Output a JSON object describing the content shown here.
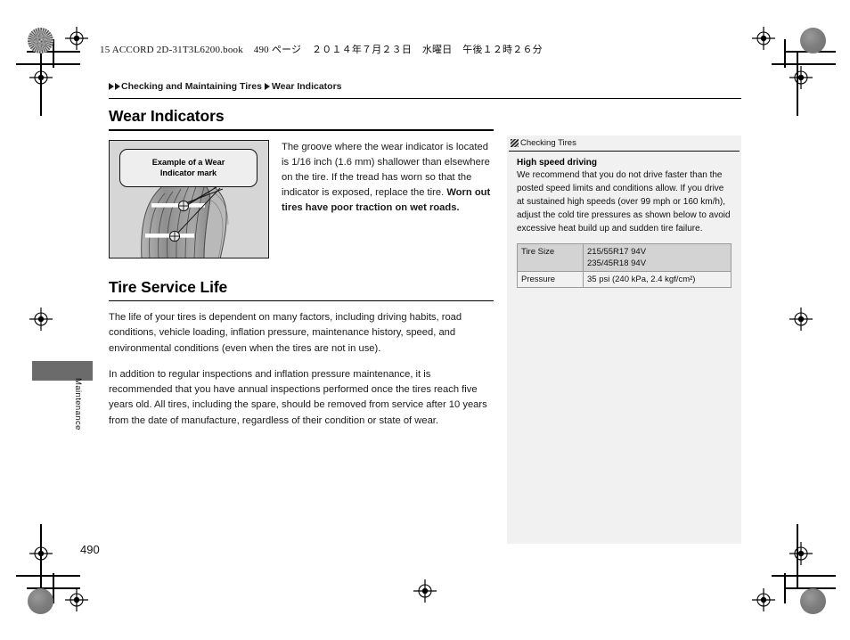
{
  "book_meta": {
    "text": "15 ACCORD 2D-31T3L6200.book",
    "page_marker": "490",
    "page_word_jp": "ページ",
    "date_jp": "２０１４年７月２３日",
    "weekday_jp": "水曜日",
    "time_jp": "午後１２時２６分"
  },
  "breadcrumb": {
    "item1": "Checking and Maintaining Tires",
    "item2": "Wear Indicators",
    "arrow_icon": "triangle-right-icon"
  },
  "sections": [
    {
      "id": "wear-indicators",
      "title": "Wear Indicators",
      "illustration": {
        "callout_line1": "Example of a Wear",
        "callout_line2": "Indicator mark",
        "alt": "tire-tread-wear-indicator-diagram"
      },
      "body_regular": "The groove where the wear indicator is located is 1/16 inch (1.6 mm) shallower than elsewhere on the tire. If the tread has worn so that the indicator is exposed, replace the tire. ",
      "body_bold": "Worn out tires have poor traction on wet roads."
    },
    {
      "id": "tire-service-life",
      "title": "Tire Service Life",
      "para1": "The life of your tires is dependent on many factors, including driving habits, road conditions, vehicle loading, inflation pressure, maintenance history, speed, and environmental conditions (even when the tires are not in use).",
      "para2": "In addition to regular inspections and inflation pressure maintenance, it is recommended that you have annual inspections performed once the tires reach five years old. All tires, including the spare, should be removed from service after 10 years from the date of manufacture, regardless of their condition or state of wear."
    }
  ],
  "side_panel": {
    "ref_icon": "reference-marker-icon",
    "ref_label": "Checking Tires",
    "title": "High speed driving",
    "paragraph": "We recommend that you do not drive faster than the posted speed limits and conditions allow. If you drive at sustained high speeds (over 99 mph or 160 km/h), adjust the cold tire pressures as shown below to avoid excessive heat build up and sudden tire failure.",
    "table": {
      "rows": [
        {
          "key": "Tire Size",
          "values": [
            "215/55R17 94V",
            "235/45R18 94V"
          ]
        },
        {
          "key": "Pressure",
          "values": [
            "35 psi (240 kPa, 2.4 kgf/cm²)"
          ]
        }
      ]
    }
  },
  "margin": {
    "chapter_tab_label": "Maintenance",
    "page_number": "490"
  },
  "colors": {
    "panel_bg": "#f1f1f1",
    "table_header_bg": "#d3d3d3",
    "illustration_bg": "#d6d6d6",
    "tab_gray": "#6b6b6b",
    "text": "#1a1a1a"
  }
}
